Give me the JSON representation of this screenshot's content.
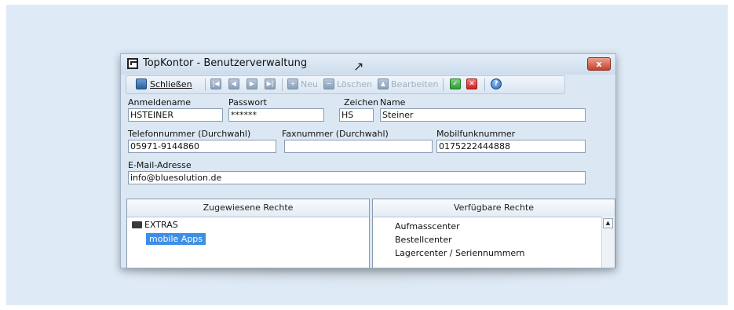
{
  "window": {
    "title": "TopKontor - Benutzerverwaltung",
    "close_label": "x"
  },
  "toolbar": {
    "close_label": "Schließen",
    "new_label": "Neu",
    "delete_label": "Löschen",
    "edit_label": "Bearbeiten"
  },
  "form": {
    "login": {
      "label": "Anmeldename",
      "value": "HSTEINER"
    },
    "password": {
      "label": "Passwort",
      "value": "******"
    },
    "initials": {
      "label": "Zeichen",
      "value": "HS"
    },
    "name": {
      "label": "Name",
      "value": "Steiner"
    },
    "phone": {
      "label": "Telefonnummer (Durchwahl)",
      "value": "05971-9144860"
    },
    "fax": {
      "label": "Faxnummer (Durchwahl)",
      "value": ""
    },
    "mobile": {
      "label": "Mobilfunknummer",
      "value": "0175222444888"
    },
    "email": {
      "label": "E-Mail-Adresse",
      "value": "info@bluesolution.de"
    }
  },
  "assigned_rights": {
    "header": "Zugewiesene Rechte",
    "folder": "EXTRAS",
    "items": [
      "mobile Apps"
    ]
  },
  "available_rights": {
    "header": "Verfügbare Rechte",
    "items": [
      "Aufmasscenter",
      "Bestellcenter",
      "Lagercenter / Seriennummern"
    ]
  },
  "colors": {
    "selection": "#3d8ee6",
    "background": "#deebf6"
  }
}
